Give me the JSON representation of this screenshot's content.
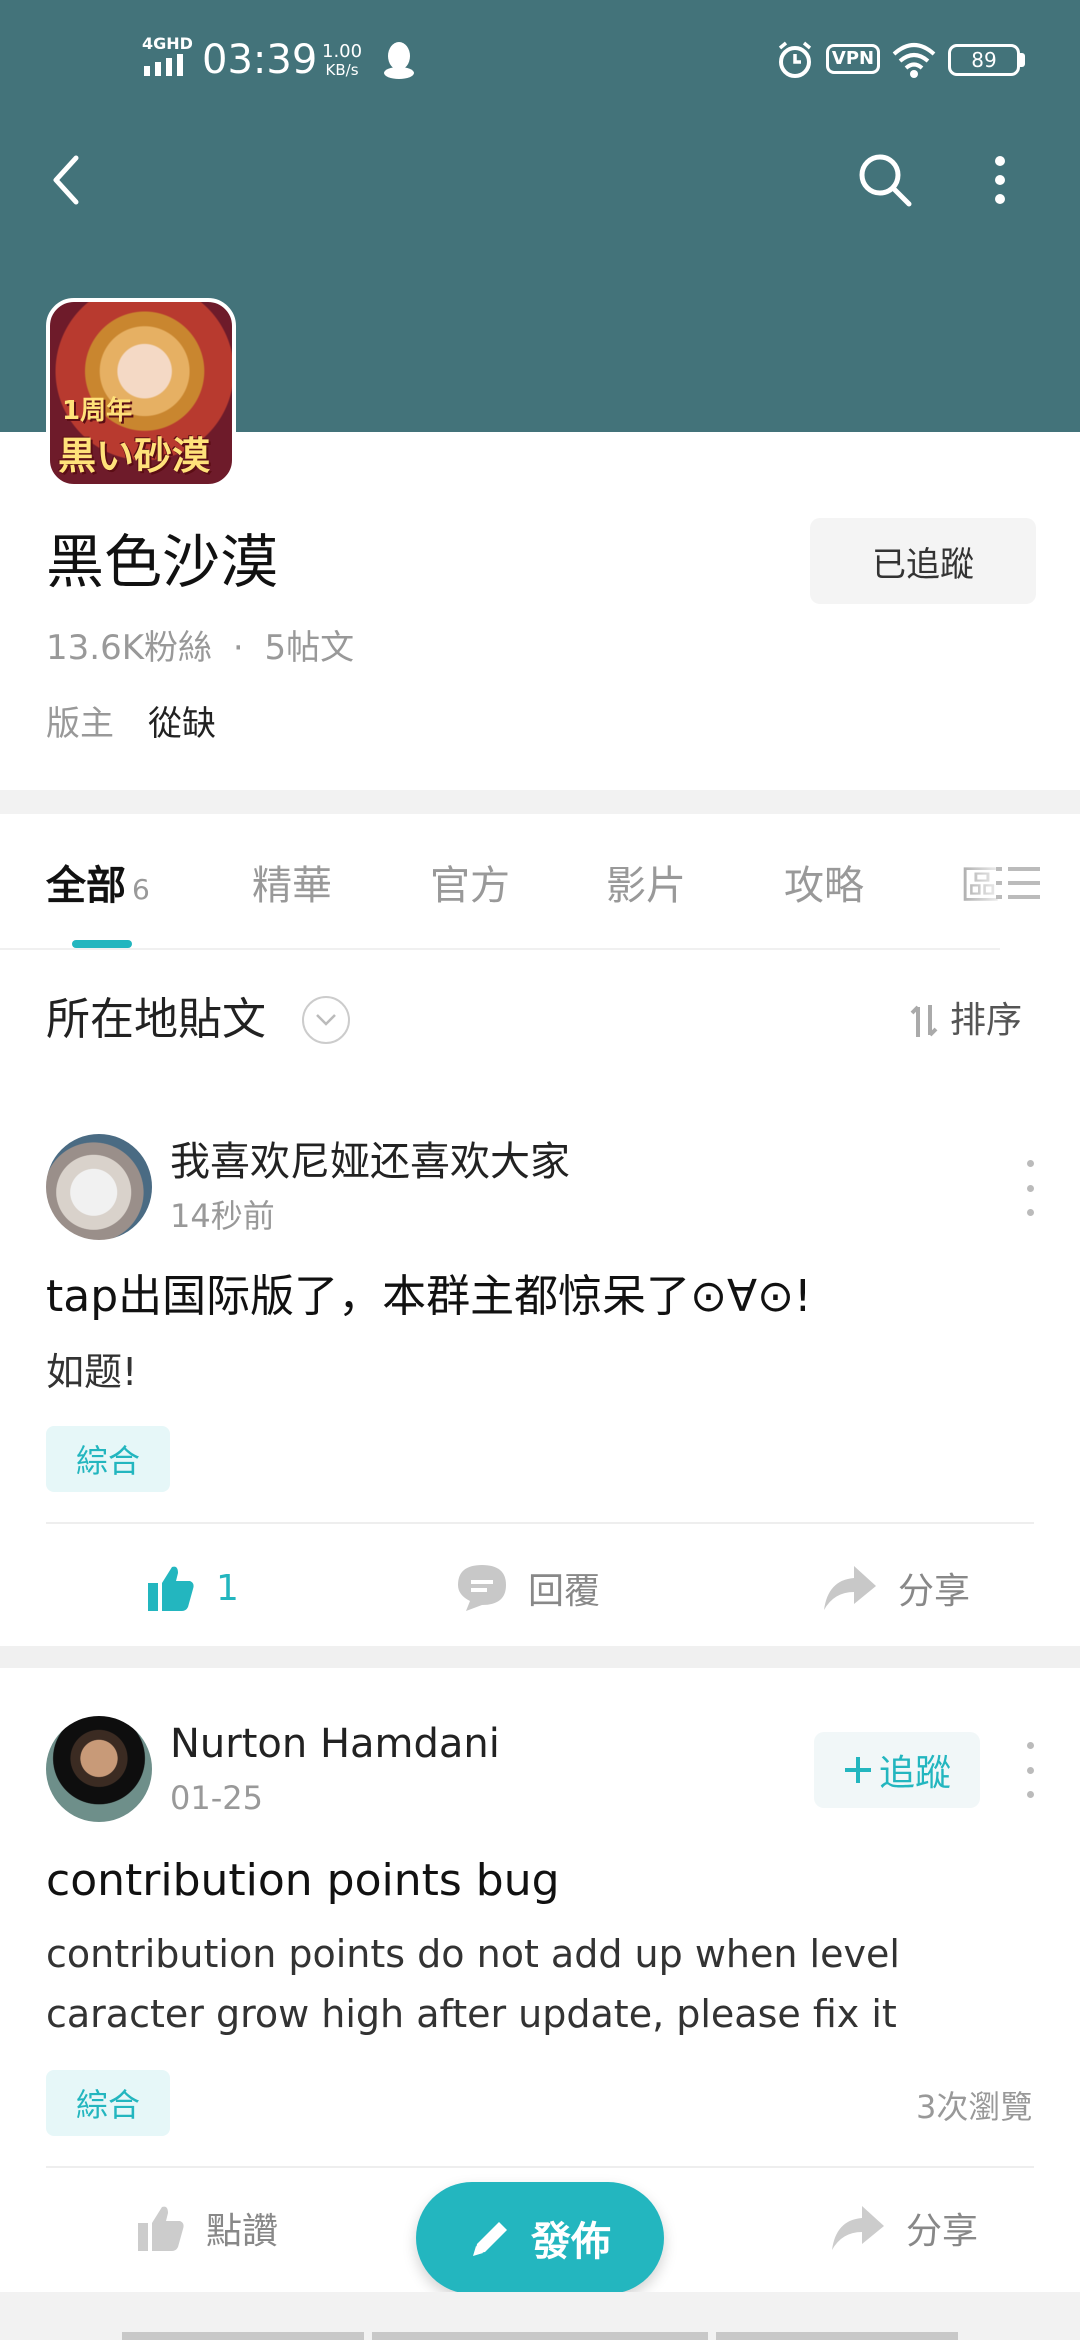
{
  "status_bar": {
    "network": "4GHD",
    "time": "03:39",
    "speed_value": "1.00",
    "speed_unit": "KB/s",
    "vpn": "VPN",
    "battery": "89"
  },
  "toolbar": {
    "back_icon": "chevron-left-icon",
    "search_icon": "search-icon",
    "more_icon": "more-vertical-icon"
  },
  "app": {
    "icon_text": "黒い砂漠",
    "icon_badge": "1周年",
    "name": "黑色沙漠",
    "followers": "13.6K粉絲",
    "separator": "·",
    "posts": "5帖文",
    "follow_state": "已追蹤",
    "moderator_label": "版主",
    "moderator_name": "從缺"
  },
  "tabs": [
    {
      "label": "全部",
      "count": "6",
      "active": true
    },
    {
      "label": "精華"
    },
    {
      "label": "官方"
    },
    {
      "label": "影片"
    },
    {
      "label": "攻略"
    },
    {
      "label": "區"
    }
  ],
  "location": {
    "title": "所在地貼文",
    "sort_label": "排序"
  },
  "posts": [
    {
      "author": "我喜欢尼娅还喜欢大家",
      "time": "14秒前",
      "title": "tap出国际版了，本群主都惊呆了⊙∀⊙!",
      "body": "如题!",
      "tag": "綜合",
      "likes": "1",
      "reply": "回覆",
      "share": "分享"
    },
    {
      "author": "Nurton Hamdani",
      "time": "01-25",
      "follow": "追蹤",
      "title": "contribution points bug",
      "body": "contribution points do not add up when level caracter grow high after update, please fix it",
      "tag": "綜合",
      "views": "3次瀏覽",
      "like": "點讚",
      "share": "分享"
    }
  ],
  "fab": {
    "label": "發佈",
    "icon": "pencil-icon"
  },
  "colors": {
    "header": "#43737a",
    "accent": "#23b6bf"
  }
}
